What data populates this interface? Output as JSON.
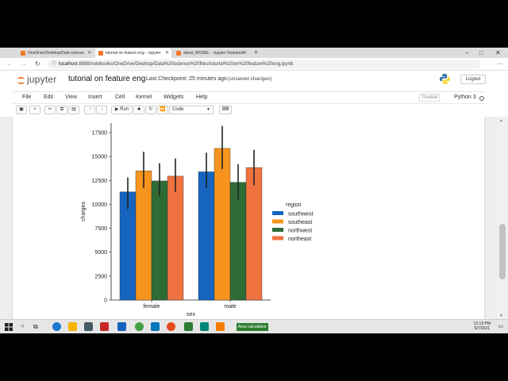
{
  "browser": {
    "tabs": [
      {
        "title": "OneDrive/Desktop/Data science",
        "active": false,
        "color": "#f37726"
      },
      {
        "title": "tutorial on feature eng - Jupyter",
        "active": true,
        "color": "#f37726"
      },
      {
        "title": "about_MODEL - Jupyter Notebook",
        "active": false,
        "color": "#f37726"
      }
    ],
    "new_tab_icon": "plus-icon",
    "url_host": "localhost",
    "url_path": ":8888/notebooks/OneDrive/Desktop/Data%20science%20files/tutorial%20on%20feature%20eng.ipynb"
  },
  "jupyter": {
    "logo_text": "jupyter",
    "notebook_title": "tutorial on feature eng",
    "checkpoint": "Last Checkpoint: 25 minutes ago",
    "unsaved": "(unsaved changes)",
    "logout_label": "Logout",
    "menu": [
      "File",
      "Edit",
      "View",
      "Insert",
      "Cell",
      "Kernel",
      "Widgets",
      "Help"
    ],
    "trusted_label": "Trusted",
    "kernel_name": "Python 3",
    "toolbar": {
      "run_label": "Run",
      "cell_type": "Code"
    }
  },
  "chart_data": {
    "type": "bar",
    "categories": [
      "female",
      "male"
    ],
    "xlabel": "sex",
    "ylabel": "charges",
    "ylim": [
      0,
      18500
    ],
    "yticks": [
      0,
      2500,
      5000,
      7500,
      10000,
      12500,
      15000,
      17500
    ],
    "legend_title": "region",
    "legend_position": "right",
    "series": [
      {
        "name": "southwest",
        "color": "#1565c0",
        "values": [
          11300,
          13400
        ],
        "err_low": [
          9500,
          11700
        ],
        "err_high": [
          12800,
          15400
        ]
      },
      {
        "name": "southeast",
        "color": "#f7941d",
        "values": [
          13500,
          15850
        ],
        "err_low": [
          11700,
          13700
        ],
        "err_high": [
          15500,
          18200
        ]
      },
      {
        "name": "northwest",
        "color": "#2e6b35",
        "values": [
          12450,
          12300
        ],
        "err_low": [
          10900,
          10500
        ],
        "err_high": [
          14300,
          14200
        ]
      },
      {
        "name": "northeast",
        "color": "#f07241",
        "values": [
          12950,
          13850
        ],
        "err_low": [
          11300,
          12000
        ],
        "err_high": [
          14800,
          15700
        ]
      }
    ]
  },
  "taskbar": {
    "search_icon": "search-icon",
    "label": "Area calculation",
    "time": "12:13 PM",
    "date": "5/7/2021"
  }
}
